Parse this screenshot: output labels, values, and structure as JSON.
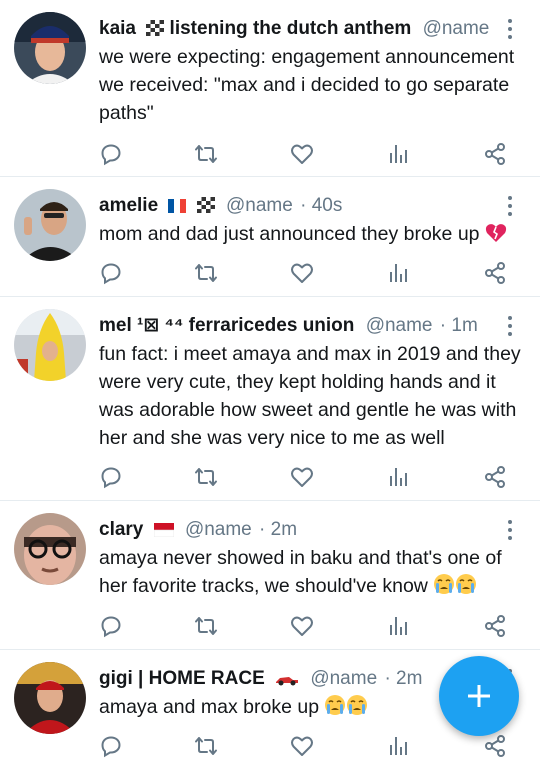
{
  "tweets": [
    {
      "name": "kaia",
      "name_suffix": "listening the dutch anthem",
      "handle": "@name ...",
      "time": "",
      "lines": [
        "we were expecting: engagement announcement",
        "we received: \"max and i decided to go separate",
        "paths\""
      ]
    },
    {
      "name": "amelie",
      "name_suffix": "",
      "handle": "@name",
      "time": "· 40s",
      "lines": [
        "mom and dad just announced they broke up"
      ]
    },
    {
      "name": "mel ¹⊠ ⁴⁴ ferraricedes union",
      "name_suffix": "",
      "handle": "@name",
      "time": "· 1m",
      "lines": [
        "fun fact: i meet amaya and max in 2019 and they",
        "were very cute, they kept holding hands and it",
        "was adorable how sweet and gentle he was with",
        "her and she was very nice to me as well"
      ]
    },
    {
      "name": "clary",
      "name_suffix": "",
      "handle": "@name",
      "time": "· 2m",
      "lines": [
        "amaya never showed in baku and that's one of",
        "her favorite tracks, we should've know"
      ]
    },
    {
      "name": "gigi | HOME RACE",
      "name_suffix": "",
      "handle": "@name",
      "time": "· 2m",
      "lines": [
        "amaya and max broke up"
      ]
    }
  ],
  "colors": {
    "accent": "#1da1f2",
    "icon": "#657786",
    "broken_heart": "#e0245e"
  },
  "icons": [
    "reply-icon",
    "retweet-icon",
    "like-icon",
    "stats-icon",
    "share-icon",
    "more-icon",
    "compose-icon"
  ]
}
